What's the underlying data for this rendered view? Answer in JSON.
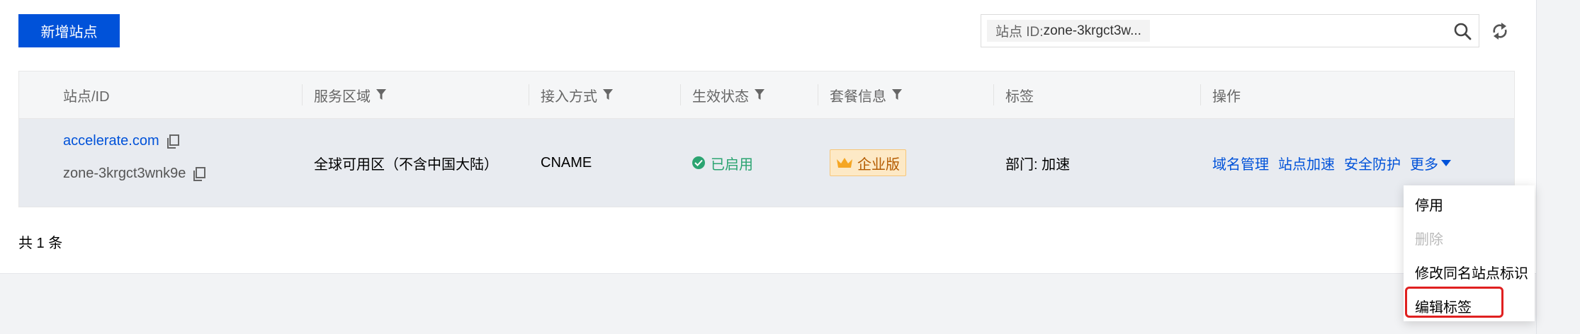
{
  "toolbar": {
    "add_site_label": "新增站点",
    "search_key": "站点 ID:",
    "search_value": "zone-3krgct3w..."
  },
  "table": {
    "headers": [
      "站点/ID",
      "服务区域",
      "接入方式",
      "生效状态",
      "套餐信息",
      "标签",
      "操作"
    ],
    "rows": [
      {
        "site": "accelerate.com",
        "zone_id": "zone-3krgct3wnk9e",
        "region": "全球可用区（不含中国大陆）",
        "access": "CNAME",
        "status": "已启用",
        "plan": "企业版",
        "tag": "部门: 加速",
        "actions": [
          "域名管理",
          "站点加速",
          "安全防护",
          "更多"
        ]
      }
    ]
  },
  "footer": {
    "total": "共 1 条"
  },
  "dropdown": {
    "items": [
      {
        "label": "停用",
        "disabled": false
      },
      {
        "label": "删除",
        "disabled": true
      },
      {
        "label": "修改同名站点标识",
        "disabled": false
      },
      {
        "label": "编辑标签",
        "disabled": false
      }
    ]
  },
  "colors": {
    "primary": "#0052d9",
    "success": "#2ba471",
    "highlight": "#e02020",
    "badge_bg": "#fde9c6",
    "badge_text": "#b45b00"
  }
}
